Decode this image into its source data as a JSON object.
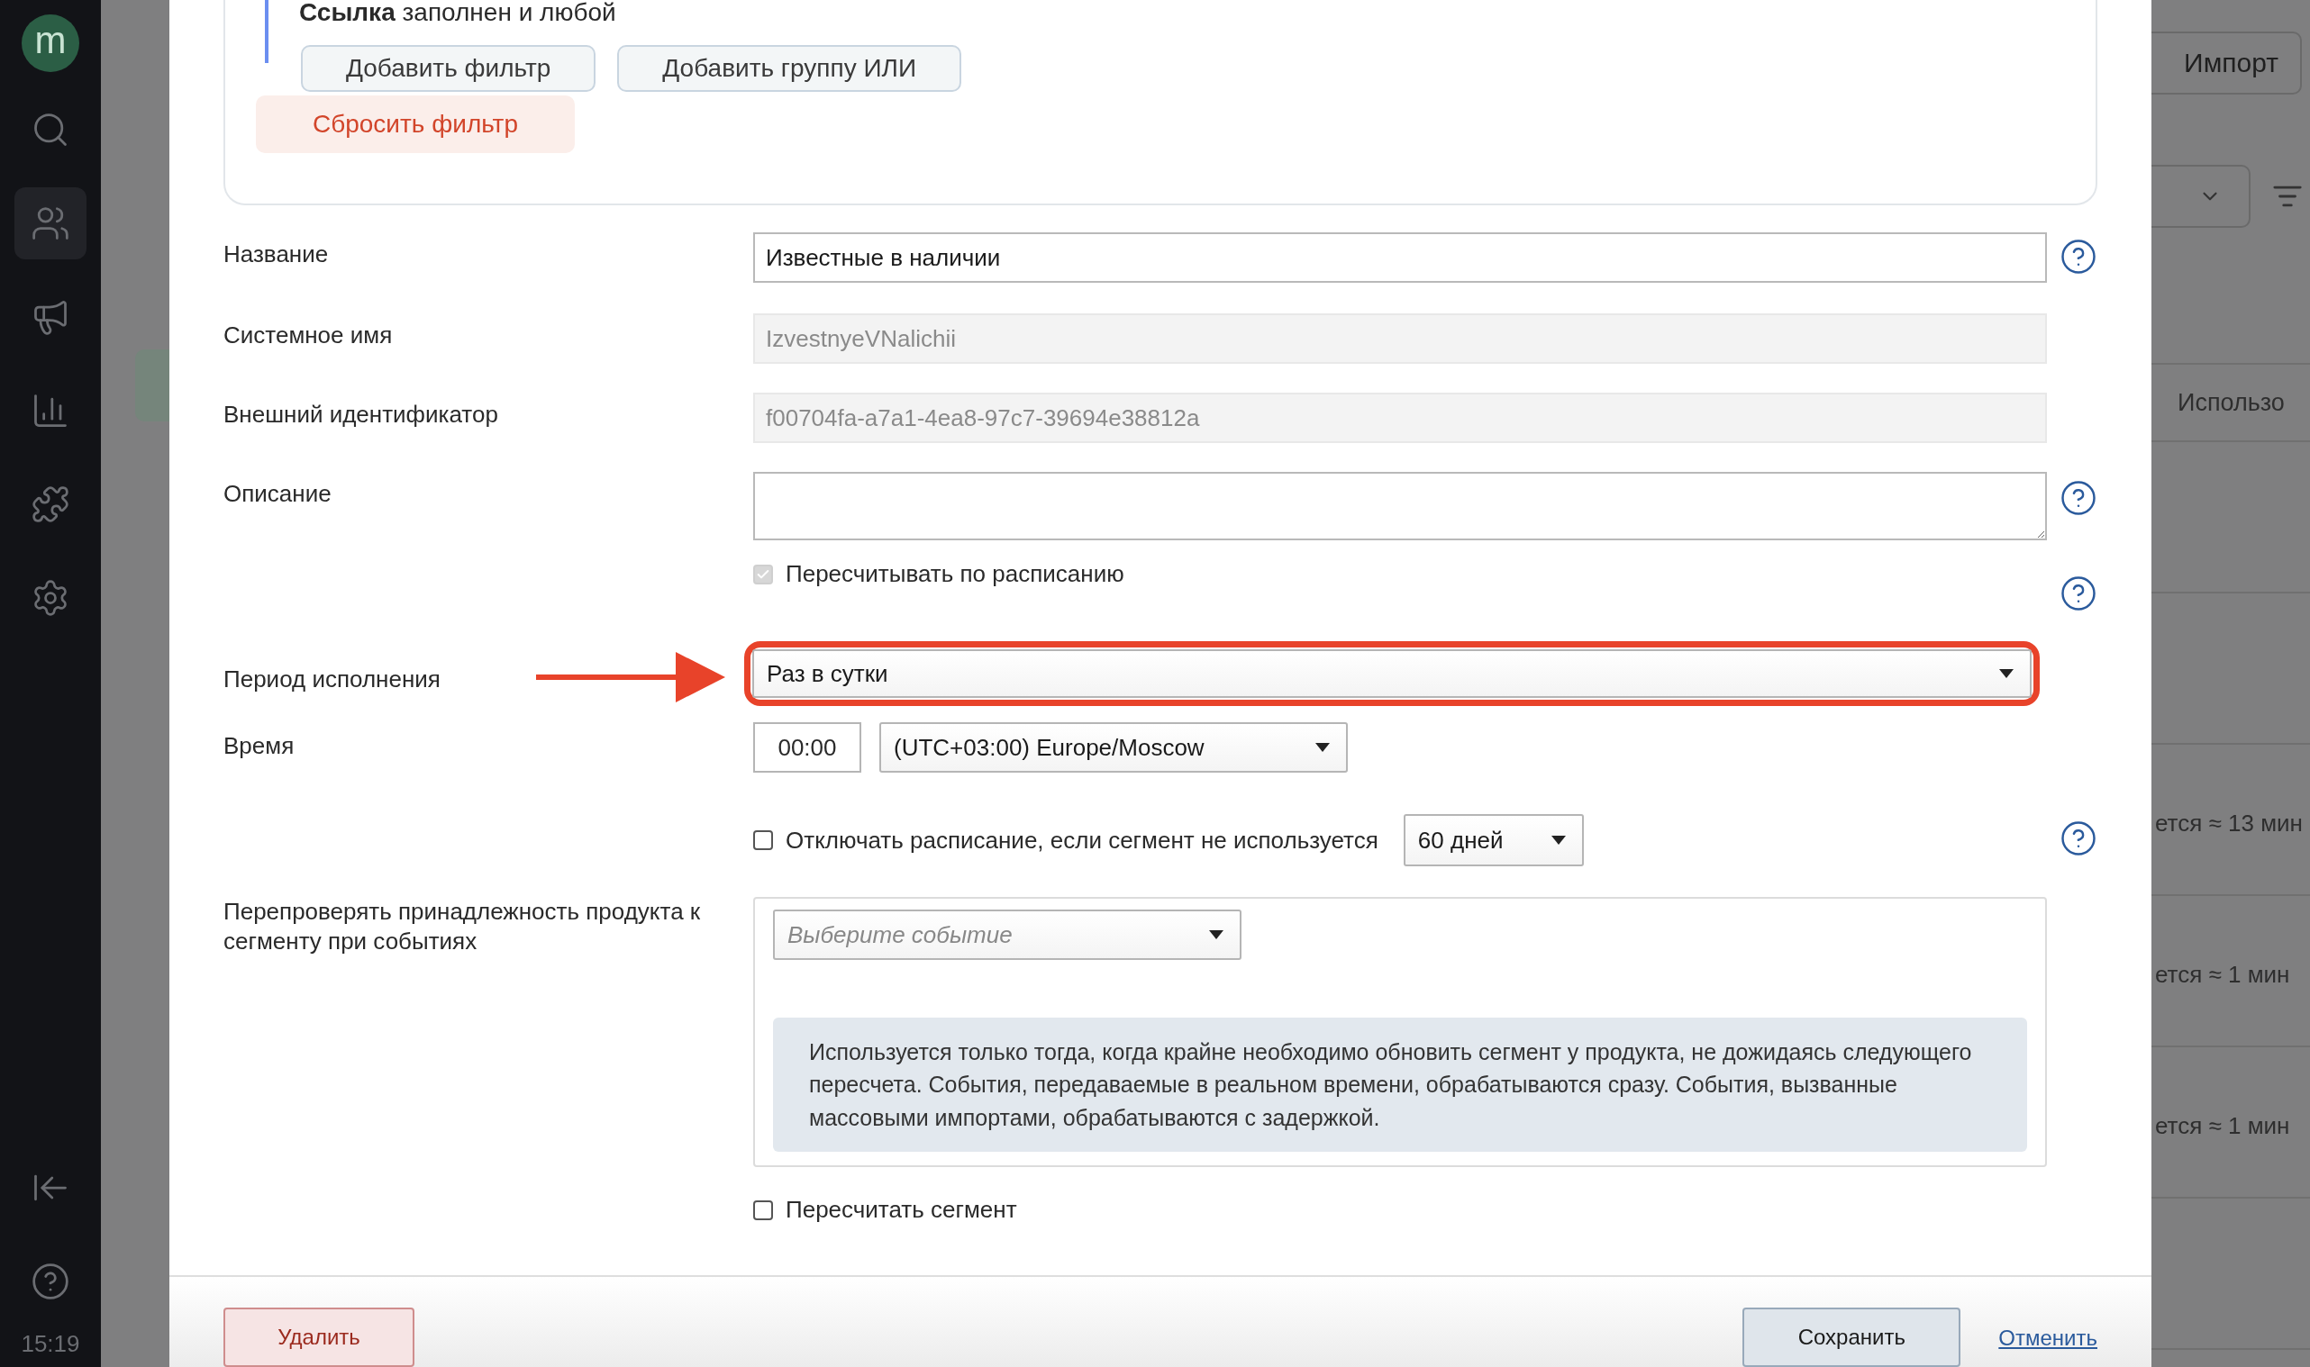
{
  "sidebar": {
    "logo": "m",
    "items": [
      {
        "kind": "search",
        "selected": false
      },
      {
        "kind": "people",
        "selected": true
      },
      {
        "kind": "megaphone",
        "selected": false
      },
      {
        "kind": "chart",
        "selected": false
      },
      {
        "kind": "puzzle",
        "selected": false
      },
      {
        "kind": "settings",
        "selected": false
      }
    ],
    "bottom": [
      {
        "kind": "collapse"
      },
      {
        "kind": "help"
      }
    ],
    "time": "15:19"
  },
  "page": {
    "import_button": "Импорт",
    "column_header": "Использо",
    "rows": [
      {
        "status": "ется ≈ 13 мин"
      },
      {
        "status": "ется ≈ 1 мин"
      },
      {
        "status": "ется ≈ 1 мин"
      },
      {}
    ]
  },
  "modal": {
    "filter": {
      "condition": "**Ссылка** заполнен и любой",
      "add_filter": "Добавить фильтр",
      "add_or_group": "Добавить группу ИЛИ",
      "reset": "Сбросить фильтр"
    },
    "name": {
      "label": "Название",
      "value": "Известные в наличии",
      "help": true
    },
    "system_name": {
      "label": "Системное имя",
      "value": "IzvestnyeVNalichii"
    },
    "external_id": {
      "label": "Внешний идентификатор",
      "value": "f00704fa-a7a1-4ea8-97c7-39694e38812a"
    },
    "description": {
      "label": "Описание",
      "help": true
    },
    "schedule": {
      "label": "Пересчитывать по расписанию",
      "checked": true,
      "disabled": true,
      "help": true
    },
    "period": {
      "label": "Период исполнения",
      "value": "Раз в сутки",
      "highlighted": true
    },
    "time": {
      "label": "Время",
      "value": "00:00",
      "timezone": "(UTC+03:00) Europe/Moscow"
    },
    "disable_unused": {
      "label": "Отключать расписание, если сегмент не используется",
      "checked": false,
      "period": "60 дней",
      "help": true
    },
    "recheck": {
      "label": "Перепроверять принадлежность продукта к сегменту при событиях",
      "placeholder": "Выберите событие",
      "info": "Используется только тогда, когда крайне необходимо обновить сегмент у продукта, не дожидаясь следующего пересчета. События, передаваемые в реальном времени, обрабатываются сразу. События, вызванные массовыми импортами, обрабатываются с задержкой."
    },
    "recalculate": {
      "label": "Пересчитать сегмент",
      "checked": false
    },
    "delete": "Удалить",
    "save": "Сохранить",
    "cancel": "Отменить"
  }
}
